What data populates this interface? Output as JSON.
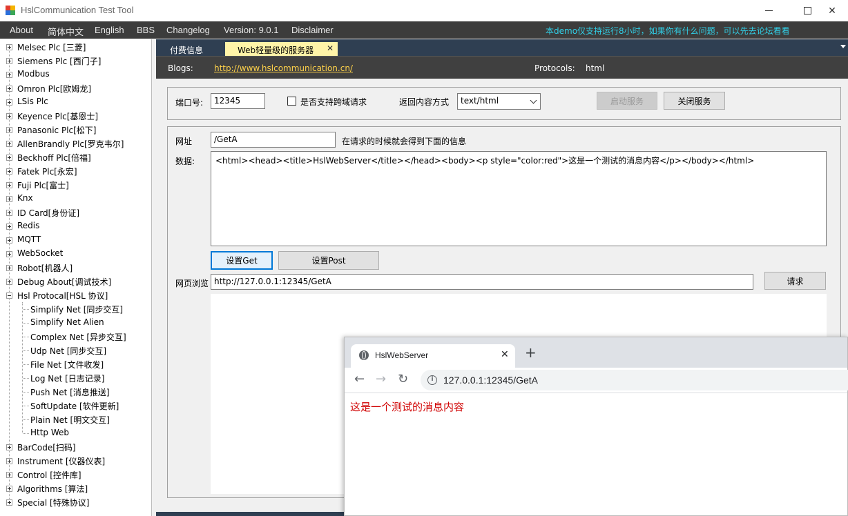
{
  "window": {
    "title": "HslCommunication Test Tool",
    "min_glyph": "",
    "close_glyph": "✕"
  },
  "menu": {
    "items": [
      "About",
      "简体中文",
      "English",
      "BBS",
      "Changelog",
      "Version: 9.0.1",
      "Disclaimer"
    ],
    "notice": "本demo仅支持运行8小时，如果你有什么问题，可以先去论坛看看"
  },
  "sidebar": {
    "top_items": [
      "Melsec Plc [三菱]",
      "Siemens Plc [西门子]",
      "Modbus",
      "Omron Plc[欧姆龙]",
      "LSis Plc",
      "Keyence Plc[基恩士]",
      "Panasonic Plc[松下]",
      "AllenBrandly Plc[罗克韦尔]",
      "Beckhoff Plc[倍福]",
      "Fatek Plc[永宏]",
      "Fuji Plc[富士]",
      "Knx",
      "ID Card[身份证]",
      "Redis",
      "MQTT",
      "WebSocket",
      "Robot[机器人]",
      "Debug About[调试技术]",
      "Hsl Protocal[HSL 协议]"
    ],
    "child_items": [
      "Simplify Net [同步交互]",
      "Simplify Net Alien",
      "Complex Net [异步交互]",
      "Udp Net [同步交互]",
      "File Net [文件收发]",
      "Log Net [日志记录]",
      "Push Net [消息推送]",
      "SoftUpdate [软件更新]",
      "Plain Net [明文交互]",
      "Http Web"
    ],
    "bottom_items": [
      "BarCode[扫码]",
      "Instrument [仪器仪表]",
      "Control [控件库]",
      "Algorithms [算法]",
      "Special [特殊协议]"
    ]
  },
  "tabs": {
    "paid": "付费信息",
    "web": "Web轻量级的服务器",
    "close": "✕"
  },
  "info_bar": {
    "blogs_label": "Blogs:",
    "blogs_url": "http://www.hslcommunication.cn/",
    "protocols_label": "Protocols:",
    "protocols_value": "html"
  },
  "server": {
    "port_label": "端口号:",
    "port_value": "12345",
    "cors_label": "是否支持跨域请求",
    "content_type_label": "返回内容方式",
    "content_type_value": "text/html",
    "start_button": "启动服务",
    "stop_button": "关闭服务"
  },
  "request": {
    "url_label": "网址",
    "url_value": "/GetA",
    "url_hint": "在请求的时候就会得到下面的信息",
    "data_label": "数据:",
    "data_value": "<html><head><title>HslWebServer</title></head><body><p style=\"color:red\">这是一个测试的消息内容</p></body></html>",
    "set_get_button": "设置Get",
    "set_post_button": "设置Post",
    "browse_label": "网页浏览",
    "browse_value": "http://127.0.0.1:12345/GetA",
    "request_button": "请求"
  },
  "browser": {
    "tab_title": "HslWebServer",
    "tab_close": "✕",
    "new_tab": "+",
    "back": "←",
    "forward": "→",
    "reload": "↻",
    "info_glyph": "i",
    "url": "127.0.0.1:12345/GetA",
    "page_text": "这是一个测试的消息内容"
  }
}
